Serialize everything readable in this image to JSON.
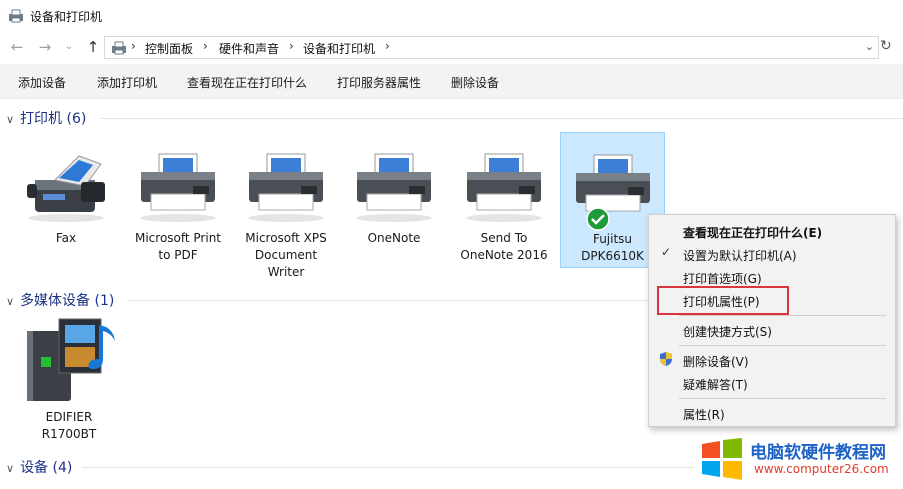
{
  "window": {
    "title": "设备和打印机",
    "icon": "devices-printers-icon"
  },
  "nav": {
    "back_icon": "arrow-left-icon",
    "forward_icon": "arrow-right-icon",
    "recent_icon": "chevron-down-icon",
    "up_icon": "arrow-up-icon",
    "refresh_icon": "refresh-icon"
  },
  "address": {
    "crumbs": [
      "控制面板",
      "硬件和声音",
      "设备和打印机"
    ],
    "separator": "›"
  },
  "commands": [
    "添加设备",
    "添加打印机",
    "查看现在正在打印什么",
    "打印服务器属性",
    "删除设备"
  ],
  "groups": {
    "printers": {
      "title": "打印机 (6)"
    },
    "multimedia": {
      "title": "多媒体设备 (1)"
    },
    "devices": {
      "title": "设备 (4)"
    }
  },
  "printers": [
    {
      "line1": "Fax",
      "line2": "",
      "line3": "",
      "icon": "fax-icon"
    },
    {
      "line1": "Microsoft Print",
      "line2": "to PDF",
      "line3": "",
      "icon": "printer-icon"
    },
    {
      "line1": "Microsoft XPS",
      "line2": "Document",
      "line3": "Writer",
      "icon": "printer-icon"
    },
    {
      "line1": "OneNote",
      "line2": "",
      "line3": "",
      "icon": "printer-icon"
    },
    {
      "line1": "Send To",
      "line2": "OneNote 2016",
      "line3": "",
      "icon": "printer-icon"
    },
    {
      "line1": "Fujitsu",
      "line2": "DPK6610K",
      "line3": "",
      "icon": "printer-icon",
      "default_badge": "check-icon"
    }
  ],
  "multimedia": [
    {
      "line1": "EDIFIER",
      "line2": "R1700BT",
      "icon": "media-device-icon"
    }
  ],
  "context_menu": {
    "items": {
      "see_printing": "查看现在正在打印什么(E)",
      "set_default": "设置为默认打印机(A)",
      "preferences": "打印首选项(G)",
      "printer_properties": "打印机属性(P)",
      "create_shortcut": "创建快捷方式(S)",
      "remove_device": "删除设备(V)",
      "troubleshoot": "疑难解答(T)",
      "properties": "属性(R)"
    }
  },
  "watermark": {
    "title": "电脑软硬件教程网",
    "url": "www.computer26.com"
  },
  "colors": {
    "accent": "#1e3287",
    "selection": "#cce8ff",
    "highlight_red": "#d9363e"
  }
}
